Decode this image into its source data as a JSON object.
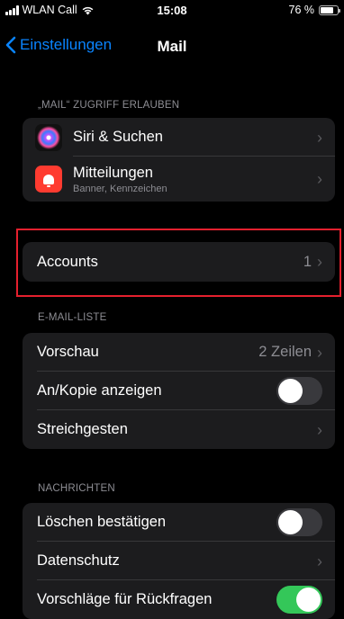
{
  "status_bar": {
    "carrier": "WLAN Call",
    "time": "15:08",
    "battery_percent": "76 %",
    "battery_level": 0.76
  },
  "nav": {
    "back_label": "Einstellungen",
    "title": "Mail"
  },
  "sections": {
    "access_header": "„MAIL“ ZUGRIFF ERLAUBEN",
    "siri_label": "Siri & Suchen",
    "notifications_label": "Mitteilungen",
    "notifications_sub": "Banner, Kennzeichen",
    "accounts_label": "Accounts",
    "accounts_value": "1",
    "mail_list_header": "E-MAIL-LISTE",
    "preview_label": "Vorschau",
    "preview_value": "2 Zeilen",
    "cc_label": "An/Kopie anzeigen",
    "cc_on": false,
    "swipe_label": "Streichgesten",
    "messages_header": "NACHRICHTEN",
    "confirm_delete_label": "Löschen bestätigen",
    "confirm_delete_on": false,
    "privacy_label": "Datenschutz",
    "followup_label": "Vorschläge für Rückfragen",
    "followup_on": true
  },
  "colors": {
    "accent": "#0a84ff",
    "toggle_on": "#34c759",
    "highlight": "#e5202e"
  }
}
